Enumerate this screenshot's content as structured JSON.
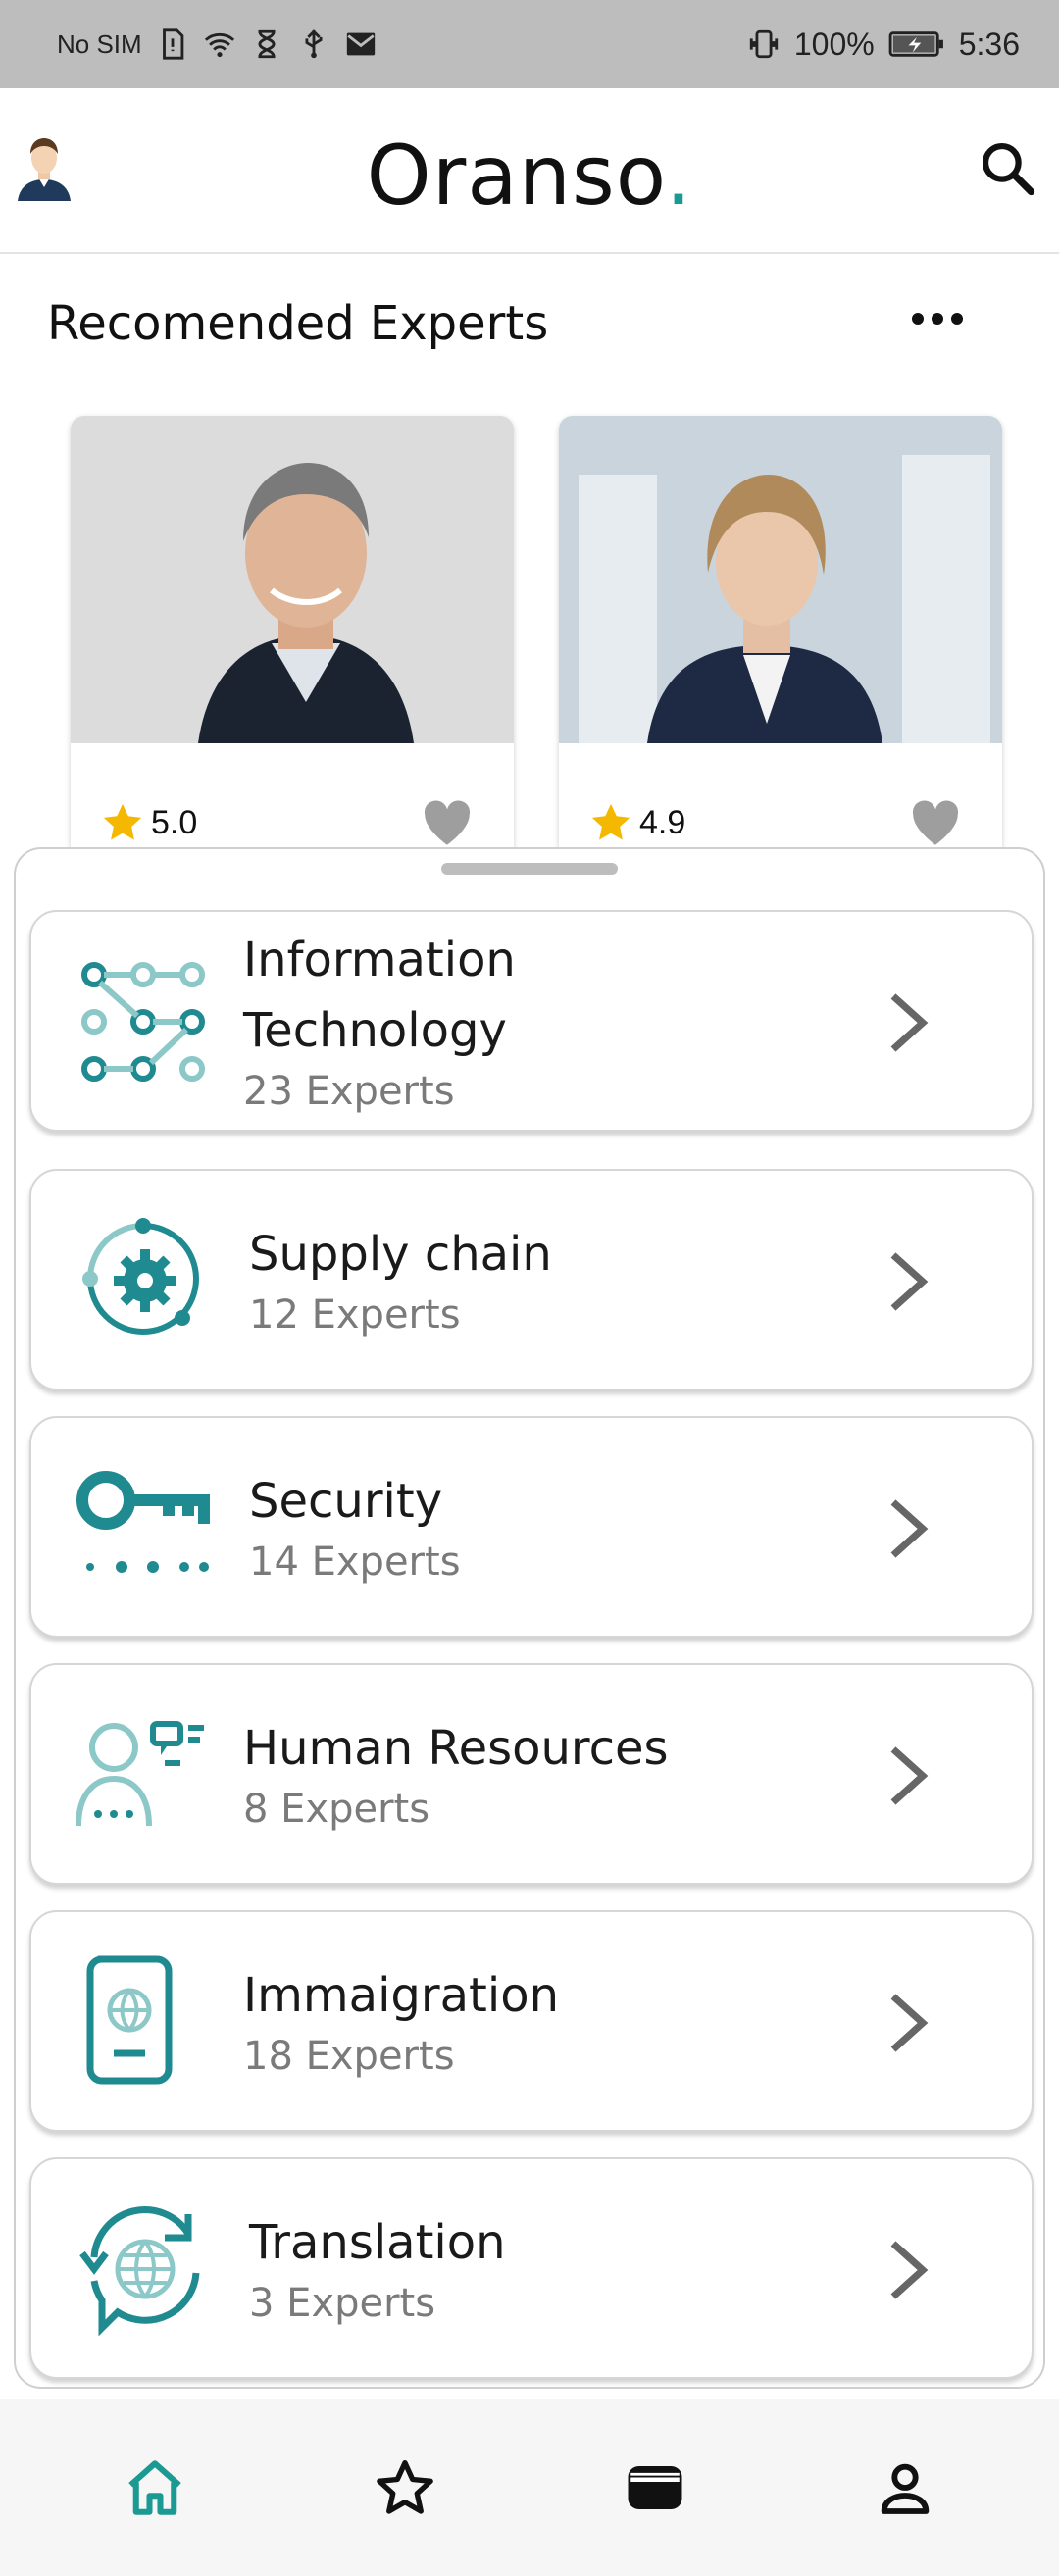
{
  "status_bar": {
    "carrier": "No SIM",
    "battery": "100%",
    "time": "5:36"
  },
  "header": {
    "brand": "Oranso",
    "brand_dot": ".",
    "brand_dot_color": "#1b9a93"
  },
  "recommended": {
    "title": "Recomended Experts",
    "experts": [
      {
        "rating": "5.0",
        "favorite_icon": "heart-icon"
      },
      {
        "rating": "4.9",
        "favorite_icon": "heart-icon"
      }
    ]
  },
  "categories": [
    {
      "name": "Information Technology",
      "count": "23 Experts",
      "icon": "network-nodes-icon"
    },
    {
      "name": "Supply chain",
      "count": "12 Experts",
      "icon": "gear-cycle-icon"
    },
    {
      "name": "Security",
      "count": "14 Experts",
      "icon": "key-icon"
    },
    {
      "name": "Human Resources",
      "count": "8 Experts",
      "icon": "person-chat-icon"
    },
    {
      "name": "Immaigration",
      "count": "18 Experts",
      "icon": "passport-icon"
    },
    {
      "name": "Translation",
      "count": "3 Experts",
      "icon": "globe-speech-icon"
    }
  ],
  "bottom_nav": [
    {
      "name": "home",
      "icon": "home-icon",
      "active": true
    },
    {
      "name": "favorites",
      "icon": "star-icon",
      "active": false
    },
    {
      "name": "wallet",
      "icon": "wallet-icon",
      "active": false
    },
    {
      "name": "profile",
      "icon": "user-icon",
      "active": false
    }
  ],
  "colors": {
    "accent": "#1b9a93",
    "icon_teal": "#1f8a8f",
    "star": "#f5b800"
  }
}
